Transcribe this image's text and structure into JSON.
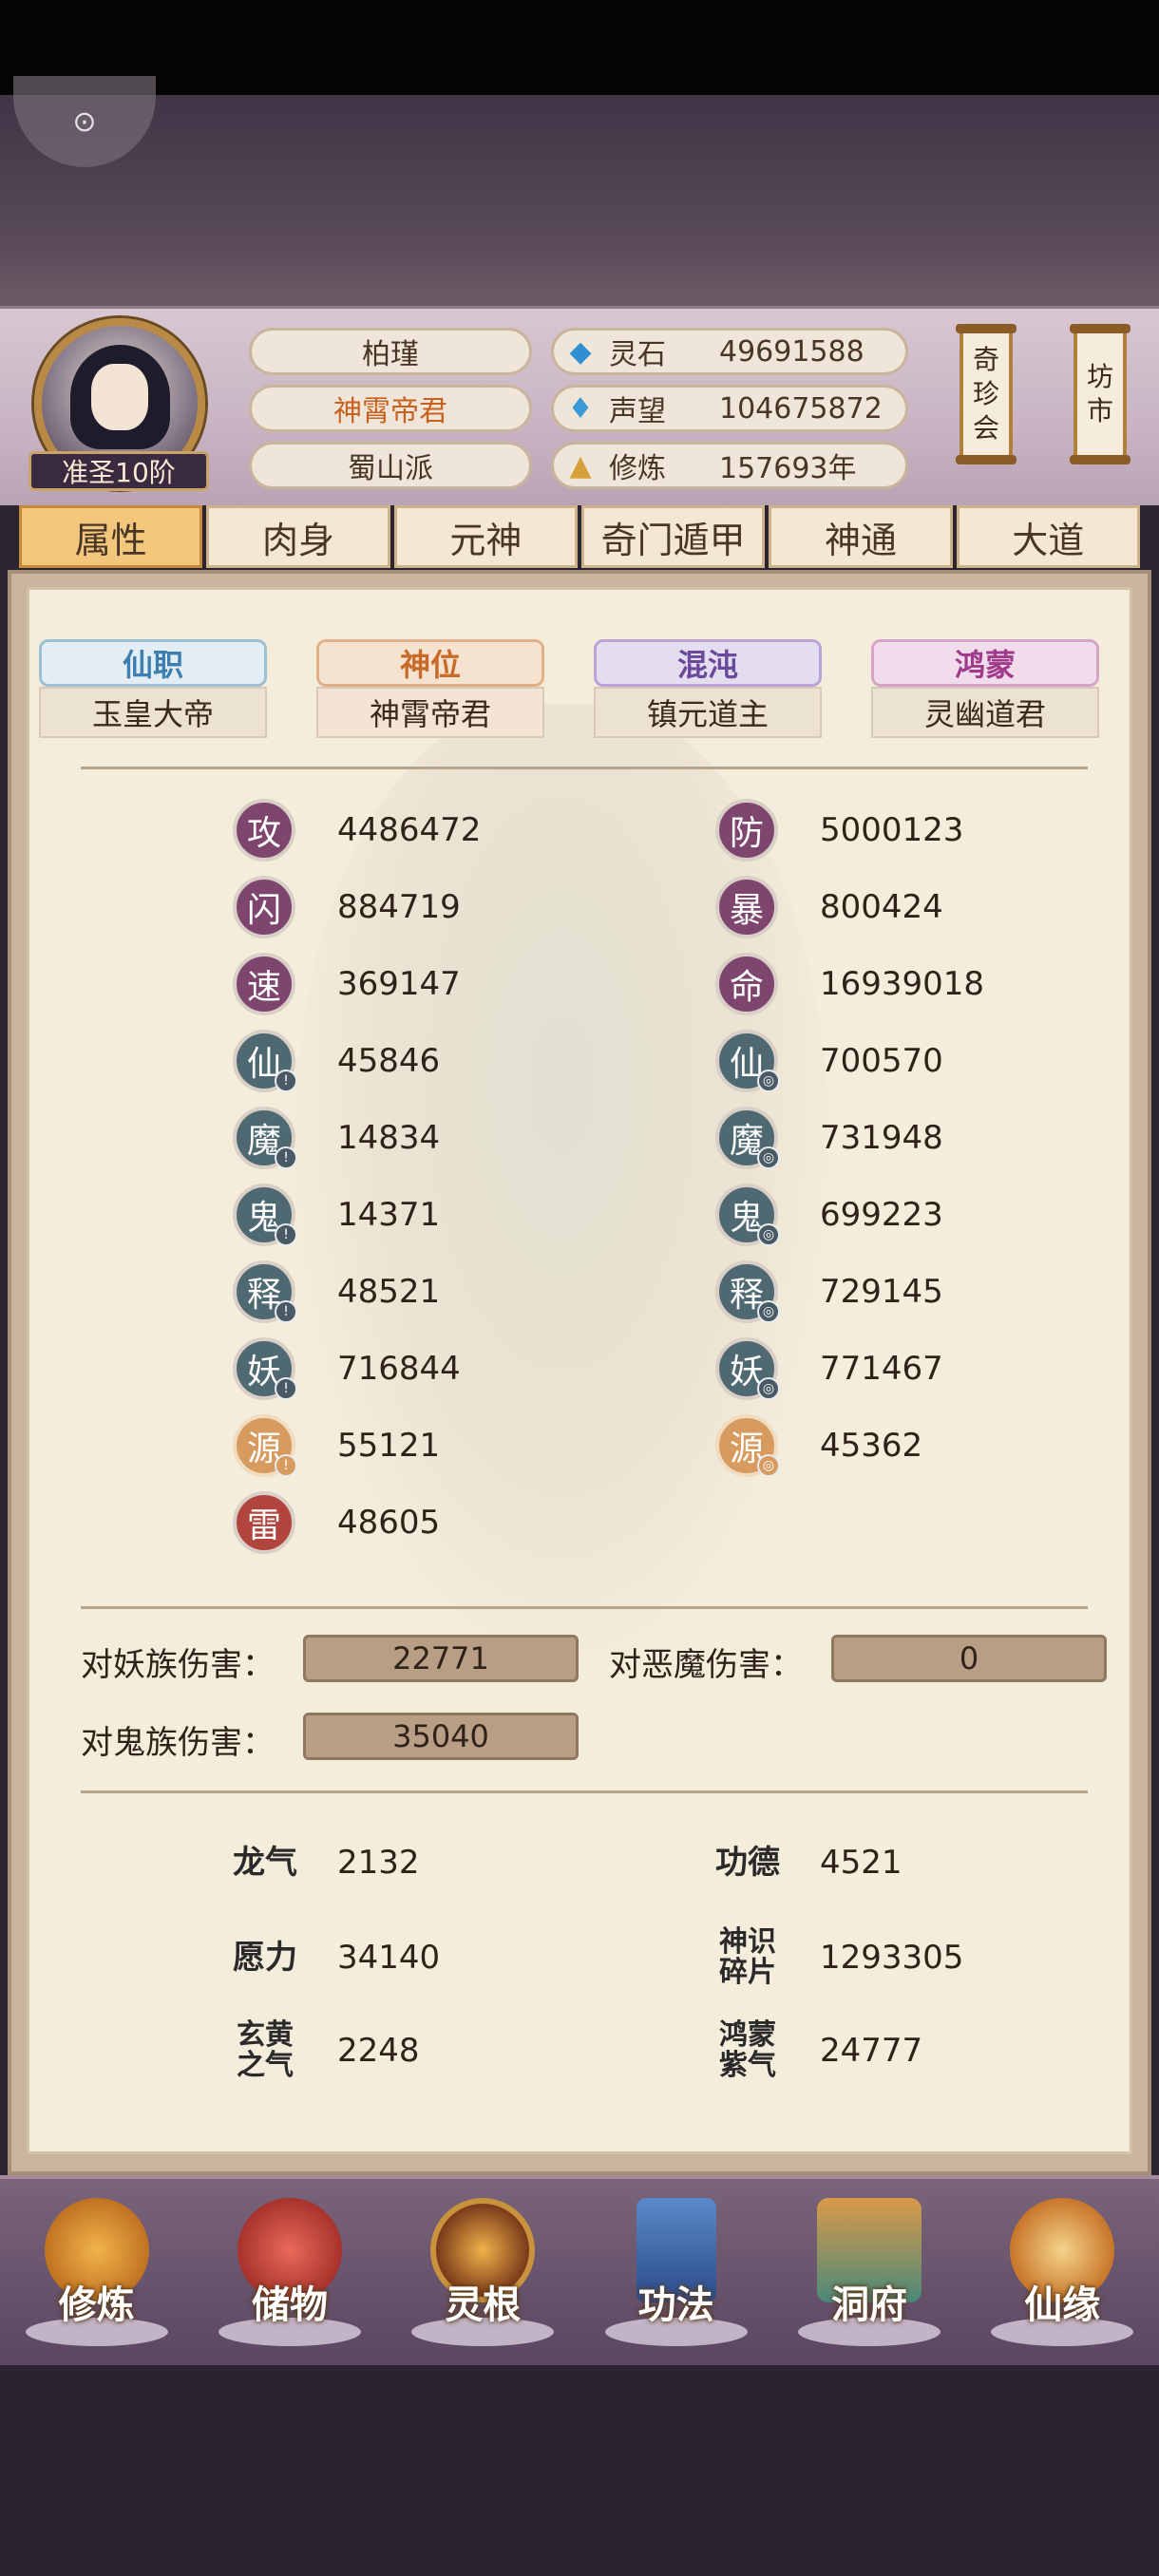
{
  "header": {
    "rank": "准圣10阶",
    "name": "柏瑾",
    "title": "神霄帝君",
    "sect": "蜀山派",
    "resources": [
      {
        "icon": "spirit-stone-icon",
        "label": "灵石",
        "value": "49691588"
      },
      {
        "icon": "reputation-icon",
        "label": "声望",
        "value": "104675872"
      },
      {
        "icon": "cultivation-icon",
        "label": "修炼",
        "value": "157693年"
      }
    ],
    "side_buttons": [
      {
        "line1": "奇",
        "line2": "珍",
        "line3": "会"
      },
      {
        "line1": "坊",
        "line2": "市"
      }
    ]
  },
  "tabs": [
    "属性",
    "肉身",
    "元神",
    "奇门遁甲",
    "神通",
    "大道"
  ],
  "active_tab": "属性",
  "categories": [
    {
      "head": "仙职",
      "sub": "玉皇大帝",
      "color": "#3f7fb0"
    },
    {
      "head": "神位",
      "sub": "神霄帝君",
      "color": "#c86b2a"
    },
    {
      "head": "混沌",
      "sub": "镇元道主",
      "color": "#6a4a9a"
    },
    {
      "head": "鸿蒙",
      "sub": "灵幽道君",
      "color": "#a03a8a"
    }
  ],
  "stats_left": [
    {
      "icon": "攻",
      "value": "4486472"
    },
    {
      "icon": "闪",
      "value": "884719"
    },
    {
      "icon": "速",
      "value": "369147"
    },
    {
      "icon": "仙",
      "value": "45846"
    },
    {
      "icon": "魔",
      "value": "14834"
    },
    {
      "icon": "鬼",
      "value": "14371"
    },
    {
      "icon": "释",
      "value": "48521"
    },
    {
      "icon": "妖",
      "value": "716844"
    },
    {
      "icon": "源",
      "value": "55121"
    },
    {
      "icon": "雷",
      "value": "48605"
    }
  ],
  "stats_right": [
    {
      "icon": "防",
      "value": "5000123"
    },
    {
      "icon": "暴",
      "value": "800424"
    },
    {
      "icon": "命",
      "value": "16939018"
    },
    {
      "icon": "仙",
      "value": "700570"
    },
    {
      "icon": "魔",
      "value": "731948"
    },
    {
      "icon": "鬼",
      "value": "699223"
    },
    {
      "icon": "释",
      "value": "729145"
    },
    {
      "icon": "妖",
      "value": "771467"
    },
    {
      "icon": "源",
      "value": "45362"
    }
  ],
  "damage": [
    {
      "label": "对妖族伤害：",
      "value": "22771"
    },
    {
      "label": "对恶魔伤害：",
      "value": "0"
    },
    {
      "label": "对鬼族伤害：",
      "value": "35040"
    }
  ],
  "misc": [
    {
      "label": "龙气",
      "value": "2132"
    },
    {
      "label": "功德",
      "value": "4521"
    },
    {
      "label": "愿力",
      "value": "34140"
    },
    {
      "label": "神识碎片",
      "value": "1293305"
    },
    {
      "label": "玄黄之气",
      "value": "2248"
    },
    {
      "label": "鸿蒙紫气",
      "value": "24777"
    }
  ],
  "nav": [
    {
      "label": "修炼",
      "icon": "meditation-icon"
    },
    {
      "label": "储物",
      "icon": "storage-bag-icon"
    },
    {
      "label": "灵根",
      "icon": "spirit-root-icon"
    },
    {
      "label": "功法",
      "icon": "manual-book-icon"
    },
    {
      "label": "洞府",
      "icon": "cave-house-icon"
    },
    {
      "label": "仙缘",
      "icon": "fortune-gourd-icon"
    }
  ]
}
